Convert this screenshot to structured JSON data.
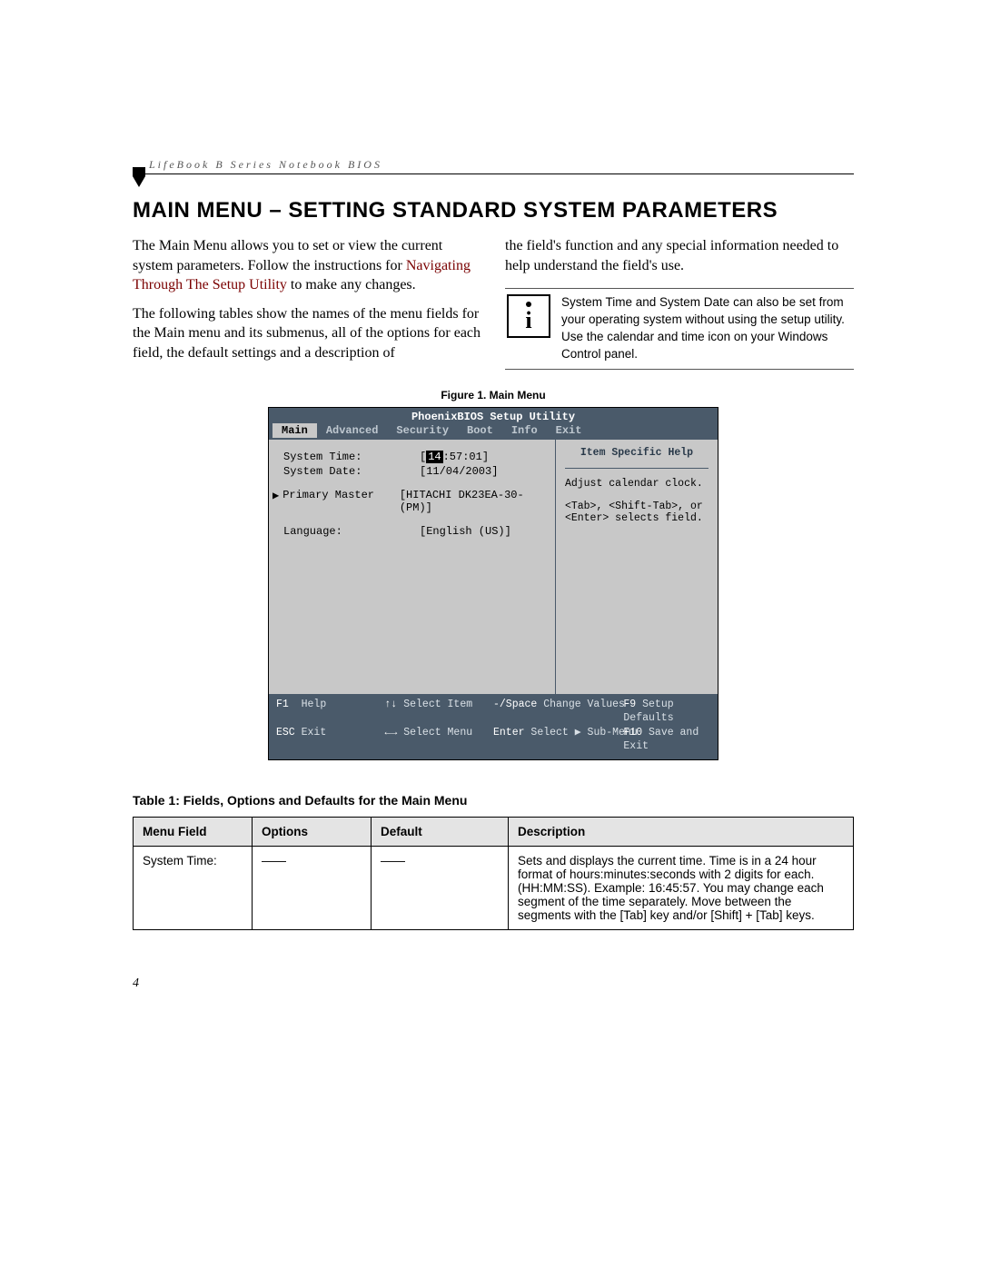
{
  "running_head": "LifeBook B Series Notebook BIOS",
  "heading": "MAIN MENU – SETTING STANDARD SYSTEM PARAMETERS",
  "col1": {
    "p1a": "The Main Menu allows you to set or view the current system parameters. Follow the instructions for ",
    "p1_link": "Navigating Through The Setup Utility",
    "p1b": " to make any changes.",
    "p2": "The following tables show the names of the menu fields for the Main menu and its submenus, all of the options for each field, the default settings and a description of"
  },
  "col2": {
    "p1": "the field's function and any special information needed to help understand the field's use.",
    "note": "System Time and System Date can also be set from your operating system without using the setup utility. Use the calendar and time icon on your Windows Control panel."
  },
  "figure_caption": "Figure 1.  Main Menu",
  "bios": {
    "title": "PhoenixBIOS Setup Utility",
    "tabs": [
      "Main",
      "Advanced",
      "Security",
      "Boot",
      "Info",
      "Exit"
    ],
    "selected_tab": "Main",
    "fields": {
      "time_label": "System Time:",
      "time_hl": "14",
      "time_rest": ":57:01]",
      "date_label": "System Date:",
      "date_value": "[11/04/2003]",
      "primary_label": "Primary Master",
      "primary_value": "[HITACHI DK23EA-30-(PM)]",
      "lang_label": "Language:",
      "lang_value": "[English (US)]"
    },
    "help": {
      "header": "Item Specific Help",
      "line1": "Adjust calendar clock.",
      "line2": "<Tab>, <Shift-Tab>, or <Enter> selects field."
    },
    "footer": {
      "f1": "F1",
      "help": "Help",
      "updown": "↑↓",
      "select_item": "Select Item",
      "minus": "-/Space",
      "change": "Change Values",
      "f9": "F9",
      "defaults": "Setup Defaults",
      "esc": "ESC",
      "exit": "Exit",
      "leftright": "←→",
      "select_menu": "Select Menu",
      "enter": "Enter",
      "submenu": "Select ▶ Sub-Menu",
      "f10": "F10",
      "save": "Save and Exit"
    }
  },
  "table_title": "Table 1: Fields, Options and Defaults for the Main Menu",
  "table": {
    "headers": [
      "Menu Field",
      "Options",
      "Default",
      "Description"
    ],
    "rows": [
      {
        "field": "System Time:",
        "options": "——",
        "default": "——",
        "desc": "Sets and displays the current time. Time is in a 24 hour format of hours:minutes:seconds with 2 digits for each. (HH:MM:SS). Example: 16:45:57. You may change each segment of the time separately. Move between the segments with the [Tab] key and/or [Shift] + [Tab] keys."
      }
    ]
  },
  "page_number": "4"
}
